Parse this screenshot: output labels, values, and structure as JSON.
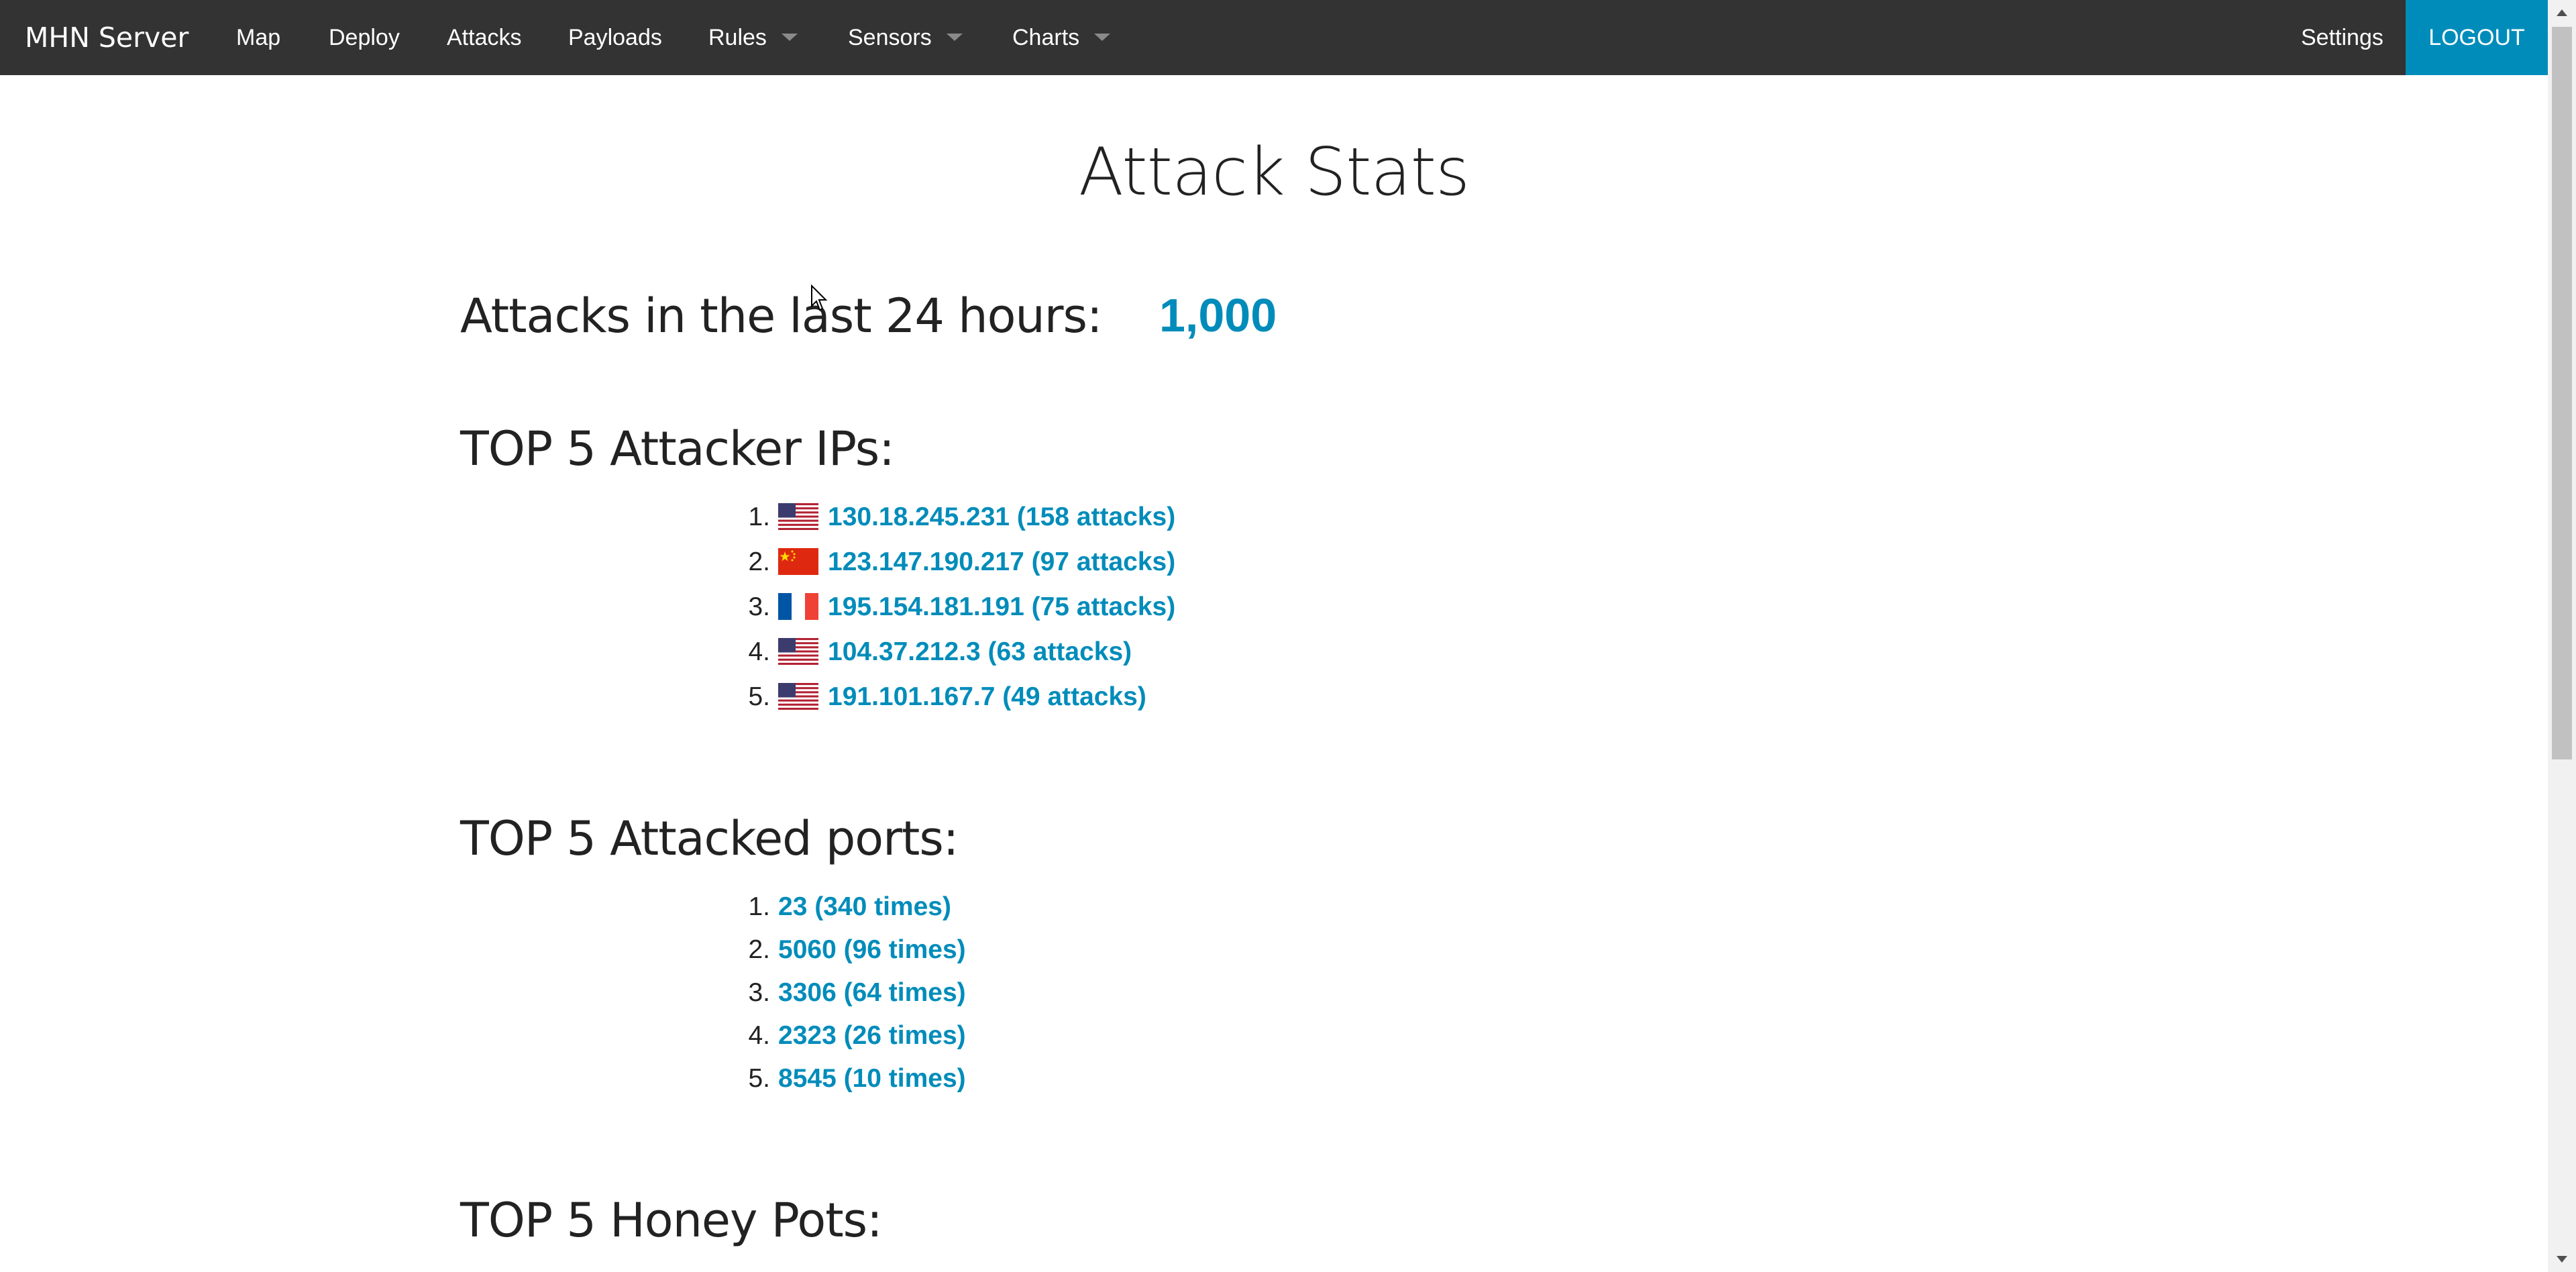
{
  "navbar": {
    "brand": "MHN Server",
    "items": [
      {
        "label": "Map"
      },
      {
        "label": "Deploy"
      },
      {
        "label": "Attacks"
      },
      {
        "label": "Payloads"
      },
      {
        "label": "Rules"
      },
      {
        "label": "Sensors"
      },
      {
        "label": "Charts"
      }
    ],
    "settings": "Settings",
    "logout": "LOGOUT",
    "accent_color": "#008cba",
    "bar_color": "#333333"
  },
  "main": {
    "title": "Attack Stats",
    "attacks_24h": {
      "label": "Attacks in the last 24 hours:",
      "value": "1,000"
    },
    "top_ips": {
      "heading": "TOP 5 Attacker IPs:",
      "items": [
        {
          "num": "1.",
          "flag": "us-flag-icon",
          "text": "130.18.245.231 (158 attacks)"
        },
        {
          "num": "2.",
          "flag": "cn-flag-icon",
          "text": "123.147.190.217 (97 attacks)"
        },
        {
          "num": "3.",
          "flag": "fr-flag-icon",
          "text": "195.154.181.191 (75 attacks)"
        },
        {
          "num": "4.",
          "flag": "us-flag-icon",
          "text": "104.37.212.3 (63 attacks)"
        },
        {
          "num": "5.",
          "flag": "us-flag-icon",
          "text": "191.101.167.7 (49 attacks)"
        }
      ]
    },
    "top_ports": {
      "heading": "TOP 5 Attacked ports:",
      "items": [
        {
          "num": "1.",
          "text": "23 (340 times)"
        },
        {
          "num": "2.",
          "text": "5060 (96 times)"
        },
        {
          "num": "3.",
          "text": "3306 (64 times)"
        },
        {
          "num": "4.",
          "text": "2323 (26 times)"
        },
        {
          "num": "5.",
          "text": "8545 (10 times)"
        }
      ]
    },
    "top_honeypots": {
      "heading": "TOP 5 Honey Pots:"
    }
  }
}
